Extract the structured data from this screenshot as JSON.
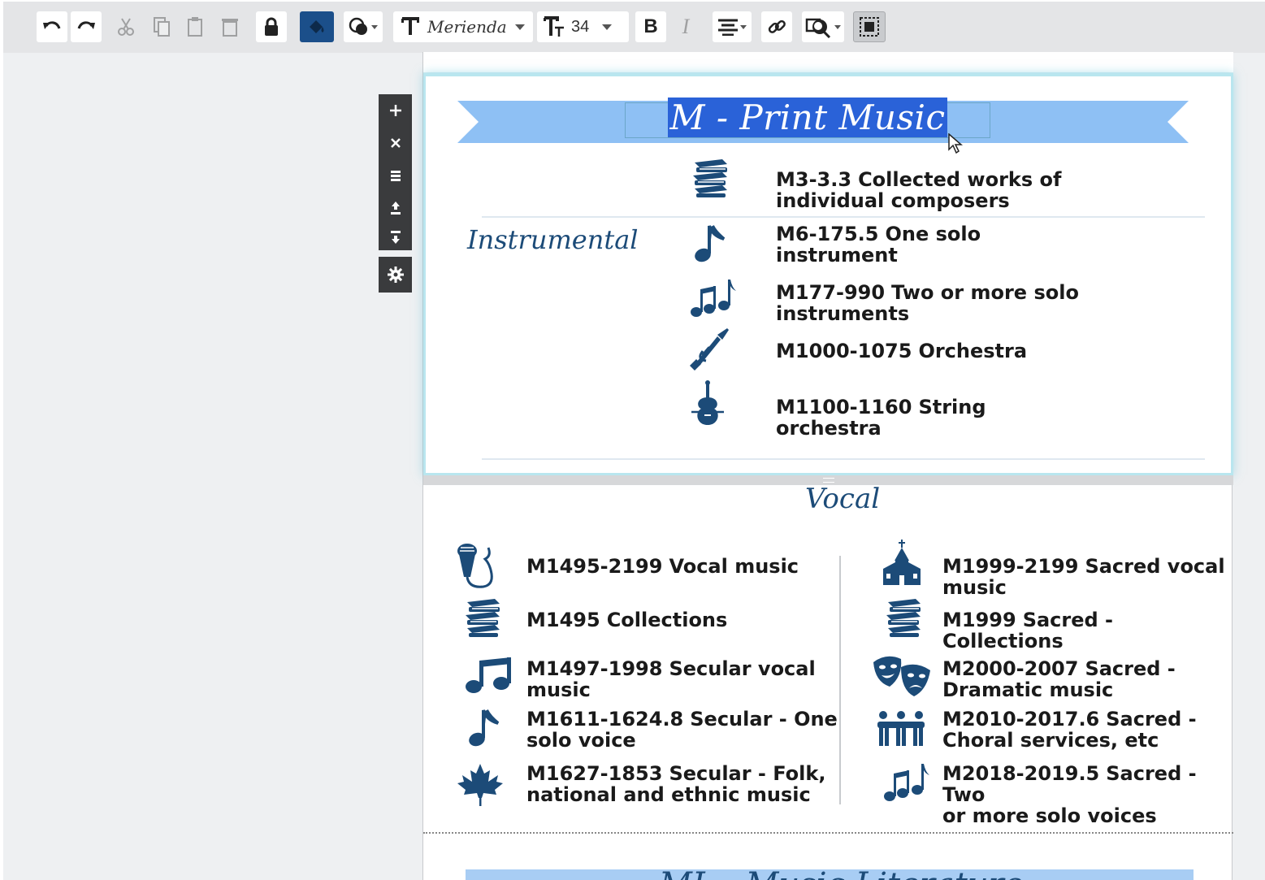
{
  "toolbar": {
    "font_name": "Merienda",
    "font_size": "34",
    "bold_label": "B",
    "italic_label": "I",
    "buttons": [
      "undo-icon",
      "redo-icon",
      "cut-icon",
      "copy-icon",
      "paste-icon",
      "delete-icon",
      "lock-icon",
      "fill-color-icon",
      "shape-icon",
      "font-family",
      "font-size",
      "bold",
      "italic",
      "align-icon",
      "link-icon",
      "image-effects-icon",
      "frame-icon"
    ]
  },
  "section_toolbar": [
    "plus-icon",
    "close-icon",
    "list-icon",
    "move-up-icon",
    "move-down-icon",
    "gear-icon"
  ],
  "document": {
    "title": "M - Print Music",
    "instrumental": {
      "label": "Instrumental",
      "items": [
        {
          "icon": "books-icon",
          "code": "M3-3.3",
          "text": "Collected works of",
          "text2": "individual composers"
        },
        {
          "icon": "eighth-note-icon",
          "code": "M6-175.5",
          "text": "One solo",
          "text2": "instrument"
        },
        {
          "icon": "multiple-notes-icon",
          "code": "M177-990",
          "text": "Two or more solo",
          "text2": "instruments"
        },
        {
          "icon": "trumpet-icon",
          "code": "M1000-1075",
          "text": "Orchestra",
          "text2": ""
        },
        {
          "icon": "violin-icon",
          "code": "M1100-1160",
          "text": "String",
          "text2": "orchestra"
        }
      ]
    },
    "vocal": {
      "label": "Vocal",
      "left_items": [
        {
          "icon": "microphone-icon",
          "code": "M1495-2199",
          "text": "Vocal music",
          "text2": ""
        },
        {
          "icon": "books-icon",
          "code": "M1495",
          "text": "Collections",
          "text2": ""
        },
        {
          "icon": "beamed-notes-icon",
          "code": "M1497-1998",
          "text": "Secular vocal",
          "text2": "music"
        },
        {
          "icon": "eighth-note-icon",
          "code": "M1611-1624.8",
          "text": "Secular - One",
          "text2": "solo voice"
        },
        {
          "icon": "maple-leaf-icon",
          "code": "M1627-1853",
          "text": "Secular - Folk,",
          "text2": "national and ethnic music"
        }
      ],
      "right_items": [
        {
          "icon": "church-icon",
          "code": "M1999-2199",
          "text": "Sacred vocal",
          "text2": "music"
        },
        {
          "icon": "books-icon",
          "code": "M1999",
          "text": "Sacred - Collections",
          "text2": ""
        },
        {
          "icon": "theater-masks-icon",
          "code": "M2000-2007",
          "text": "Sacred -",
          "text2": "Dramatic music"
        },
        {
          "icon": "choir-icon",
          "code": "M2010-2017.6",
          "text": "Sacred -",
          "text2": "Choral services, etc"
        },
        {
          "icon": "multiple-notes-icon",
          "code": "M2018-2019.5",
          "text": "Sacred - Two",
          "text2": "or more solo voices"
        }
      ]
    },
    "next_banner": "ML - Music Literature"
  },
  "colors": {
    "banner": "#8ec0f4",
    "navy": "#1c4b78",
    "highlight": "#2a62d8",
    "section_glow": "#b9e6ef"
  }
}
